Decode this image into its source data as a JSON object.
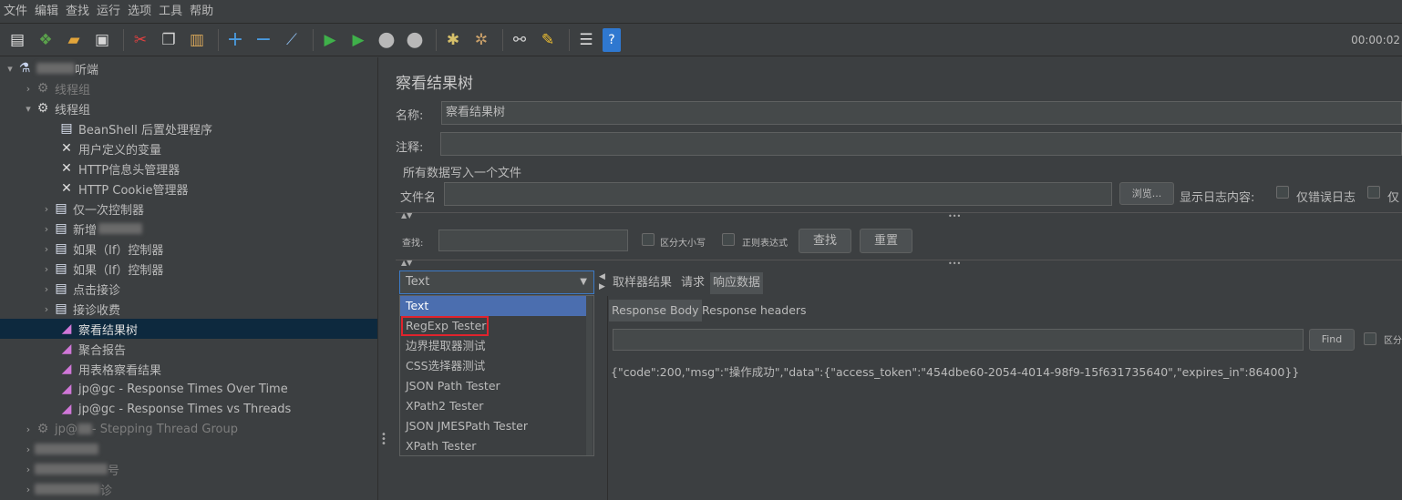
{
  "menu": [
    "文件",
    "编辑",
    "查找",
    "运行",
    "选项",
    "工具",
    "帮助"
  ],
  "toolbar": {
    "icons": [
      "new-icon",
      "templates-icon",
      "open-icon",
      "save-icon",
      "cut-icon",
      "copy-icon",
      "paste-icon",
      "expand-icon",
      "collapse-icon",
      "toggle-icon",
      "start-icon",
      "start-no-pause-icon",
      "stop-icon",
      "shutdown-icon",
      "clear-icon",
      "clear-all-icon",
      "search-icon",
      "reset-search-icon",
      "function-helper-icon",
      "help-icon"
    ],
    "timer": "00:00:02"
  },
  "tree": {
    "root_suffix": "听端",
    "group1": "线程组",
    "group2": "线程组",
    "items": [
      "BeanShell 后置处理程序",
      "用户定义的变量",
      "HTTP信息头管理器",
      "HTTP Cookie管理器",
      "仅一次控制器",
      "新增",
      "如果（If）控制器",
      "如果（If）控制器",
      "点击接诊",
      "接诊收费",
      "察看结果树",
      "聚合报告",
      "用表格察看结果",
      "jp@gc - Response Times Over Time",
      "jp@gc - Response Times vs Threads"
    ],
    "stepping_prefix": "jp@",
    "stepping_suffix": " - Stepping Thread Group",
    "blur_item_2": "号",
    "blur_item_3": "诊"
  },
  "panel": {
    "title": "察看结果树",
    "name_label": "名称:",
    "name_value": "察看结果树",
    "comment_label": "注释:",
    "comment_value": "",
    "file_section": "所有数据写入一个文件",
    "filename_label": "文件名",
    "filename_value": "",
    "browse": "浏览...",
    "log_label": "显示日志内容:",
    "errors_only": "仅错误日志",
    "success_only": "仅",
    "search_label": "查找:",
    "search_value": "",
    "case_sensitive": "区分大小写",
    "regex": "正则表达式",
    "find_button": "查找",
    "reset_button": "重置"
  },
  "renderer": {
    "selected": "Text",
    "options": [
      "Text",
      "RegExp Tester",
      "边界提取器测试",
      "CSS选择器测试",
      "JSON Path Tester",
      "XPath2 Tester",
      "JSON JMESPath Tester",
      "XPath Tester"
    ]
  },
  "result_tabs": [
    "取样器结果",
    "请求",
    "响应数据"
  ],
  "sub_tabs": [
    "Response Body",
    "Response headers"
  ],
  "response": {
    "find_button": "Find",
    "case_label": "区分",
    "body": "{\"code\":200,\"msg\":\"操作成功\",\"data\":{\"access_token\":\"454dbe60-2054-4014-98f9-15f631735640\",\"expires_in\":86400}}"
  }
}
